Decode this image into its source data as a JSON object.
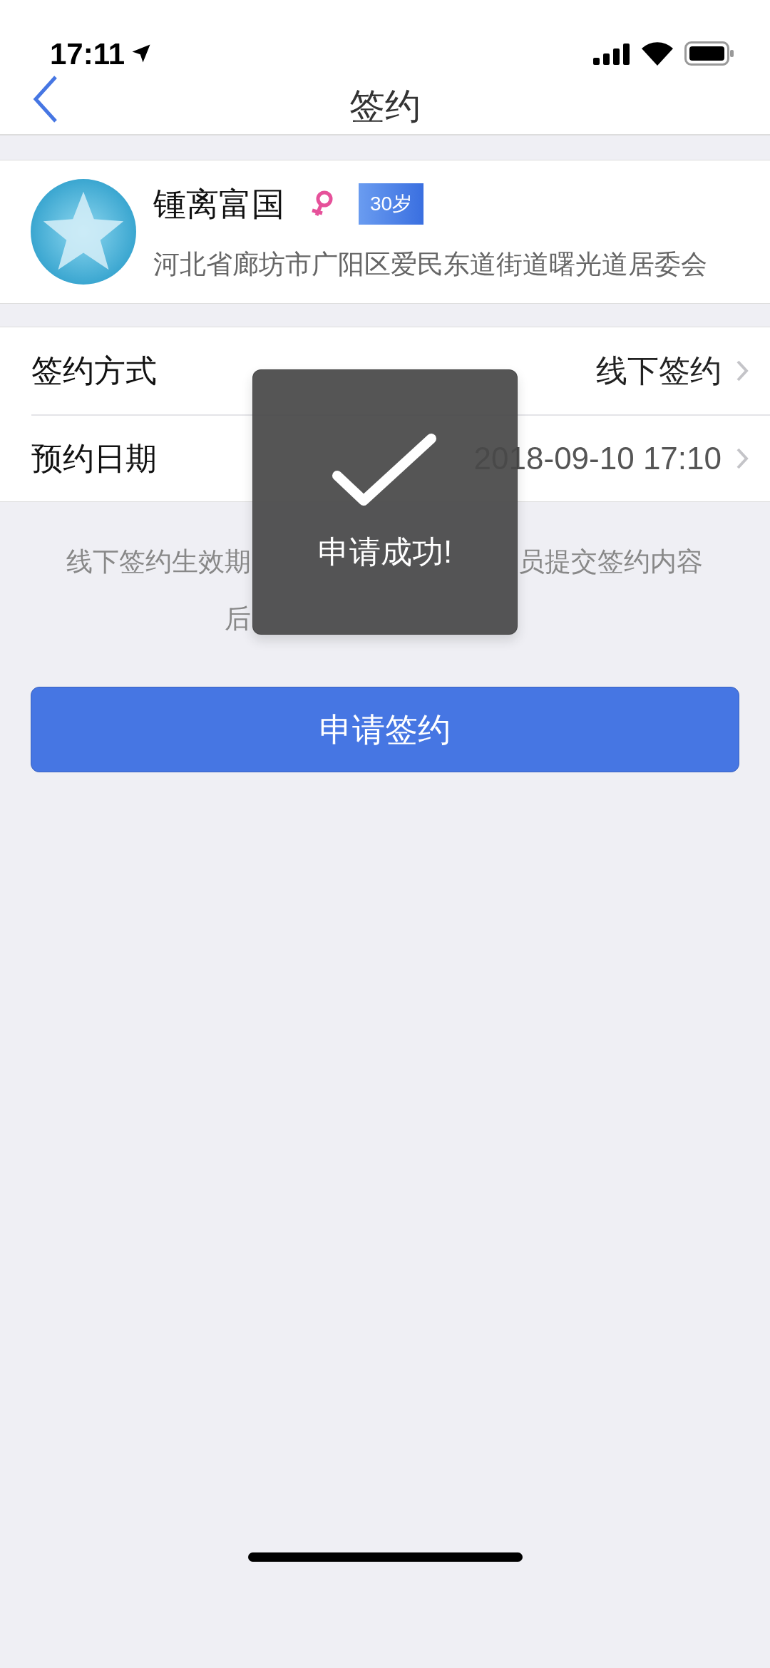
{
  "status_bar": {
    "time": "17:11"
  },
  "nav": {
    "title": "签约"
  },
  "profile": {
    "name": "锺离富国",
    "age": "30岁",
    "address": "河北省廊坊市广阳区爱民东道街道曙光道居委会"
  },
  "rows": [
    {
      "label": "签约方式",
      "value": "线下签约"
    },
    {
      "label": "预约日期",
      "value": "2018-09-10 17:10"
    }
  ],
  "note": [
    {
      "left": "线下签约生效期",
      "right": "员提交签约内容"
    },
    {
      "left": "后"
    }
  ],
  "button": "申请签约",
  "toast": {
    "message": "申请成功!"
  }
}
